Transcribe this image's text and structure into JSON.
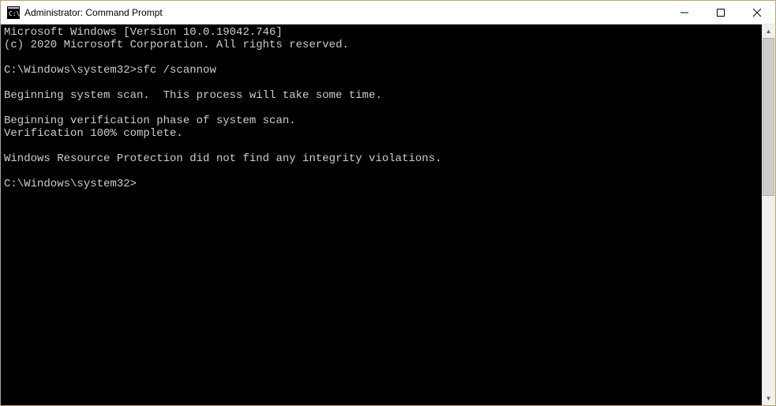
{
  "window": {
    "title": "Administrator: Command Prompt"
  },
  "terminal": {
    "lines": [
      "Microsoft Windows [Version 10.0.19042.746]",
      "(c) 2020 Microsoft Corporation. All rights reserved.",
      "",
      "C:\\Windows\\system32>sfc /scannow",
      "",
      "Beginning system scan.  This process will take some time.",
      "",
      "Beginning verification phase of system scan.",
      "Verification 100% complete.",
      "",
      "Windows Resource Protection did not find any integrity violations.",
      "",
      "C:\\Windows\\system32>"
    ]
  }
}
